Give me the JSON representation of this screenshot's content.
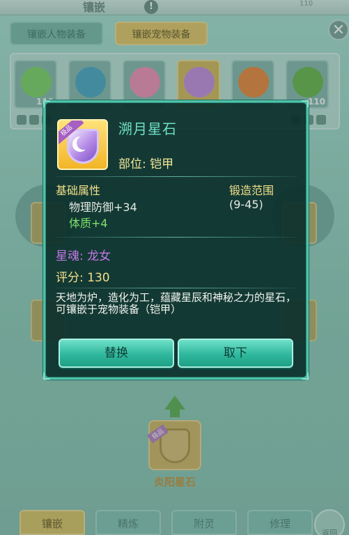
{
  "header": {
    "title": "镶嵌",
    "info_icon": "info-icon",
    "badge": "110",
    "close_icon": "close-icon"
  },
  "tabs": [
    {
      "label": "镶嵌人物装备",
      "active": false
    },
    {
      "label": "镶嵌宠物装备",
      "active": true
    }
  ],
  "pets": [
    {
      "level": "110",
      "color": "#7fd06a"
    },
    {
      "level": "",
      "color": "#4fa6c4"
    },
    {
      "level": "",
      "color": "#f08fb8"
    },
    {
      "level": "",
      "color": "#c58de0"
    },
    {
      "level": "",
      "color": "#e9873e"
    },
    {
      "level": "110",
      "color": "#6bb54e"
    }
  ],
  "equip_preview": {
    "label": ""
  },
  "gem_slot": {
    "tag": "极品",
    "name": "炎阳星石"
  },
  "bottom_tabs": [
    {
      "label": "镶嵌",
      "active": true
    },
    {
      "label": "精炼",
      "active": false
    },
    {
      "label": "附灵",
      "active": false
    },
    {
      "label": "修理",
      "active": false
    }
  ],
  "back": {
    "label": "返回",
    "icon": "back-arrow-icon"
  },
  "tooltip": {
    "rarity": "极品",
    "name": "溯月星石",
    "slot": "部位: 铠甲",
    "attr_title": "基础属性",
    "forge_title": "锻造范围",
    "attributes": [
      {
        "text": "物理防御+34",
        "range": "(9-45)",
        "color": "#e6e9e2"
      },
      {
        "text": "体质+4",
        "range": "",
        "color": "#7ee36b"
      }
    ],
    "soul": "星魂: 龙女",
    "score": "评分: 130",
    "description": "天地为炉，造化为工，蕴藏星辰和神秘之力的星石，可镶嵌于宠物装备（铠甲）",
    "buttons": {
      "replace": "替换",
      "remove": "取下"
    },
    "colors": {
      "name": "#6fe0c8",
      "gold": "#f2e08a",
      "soul": "#c477e8",
      "bonus": "#7ee36b"
    }
  }
}
